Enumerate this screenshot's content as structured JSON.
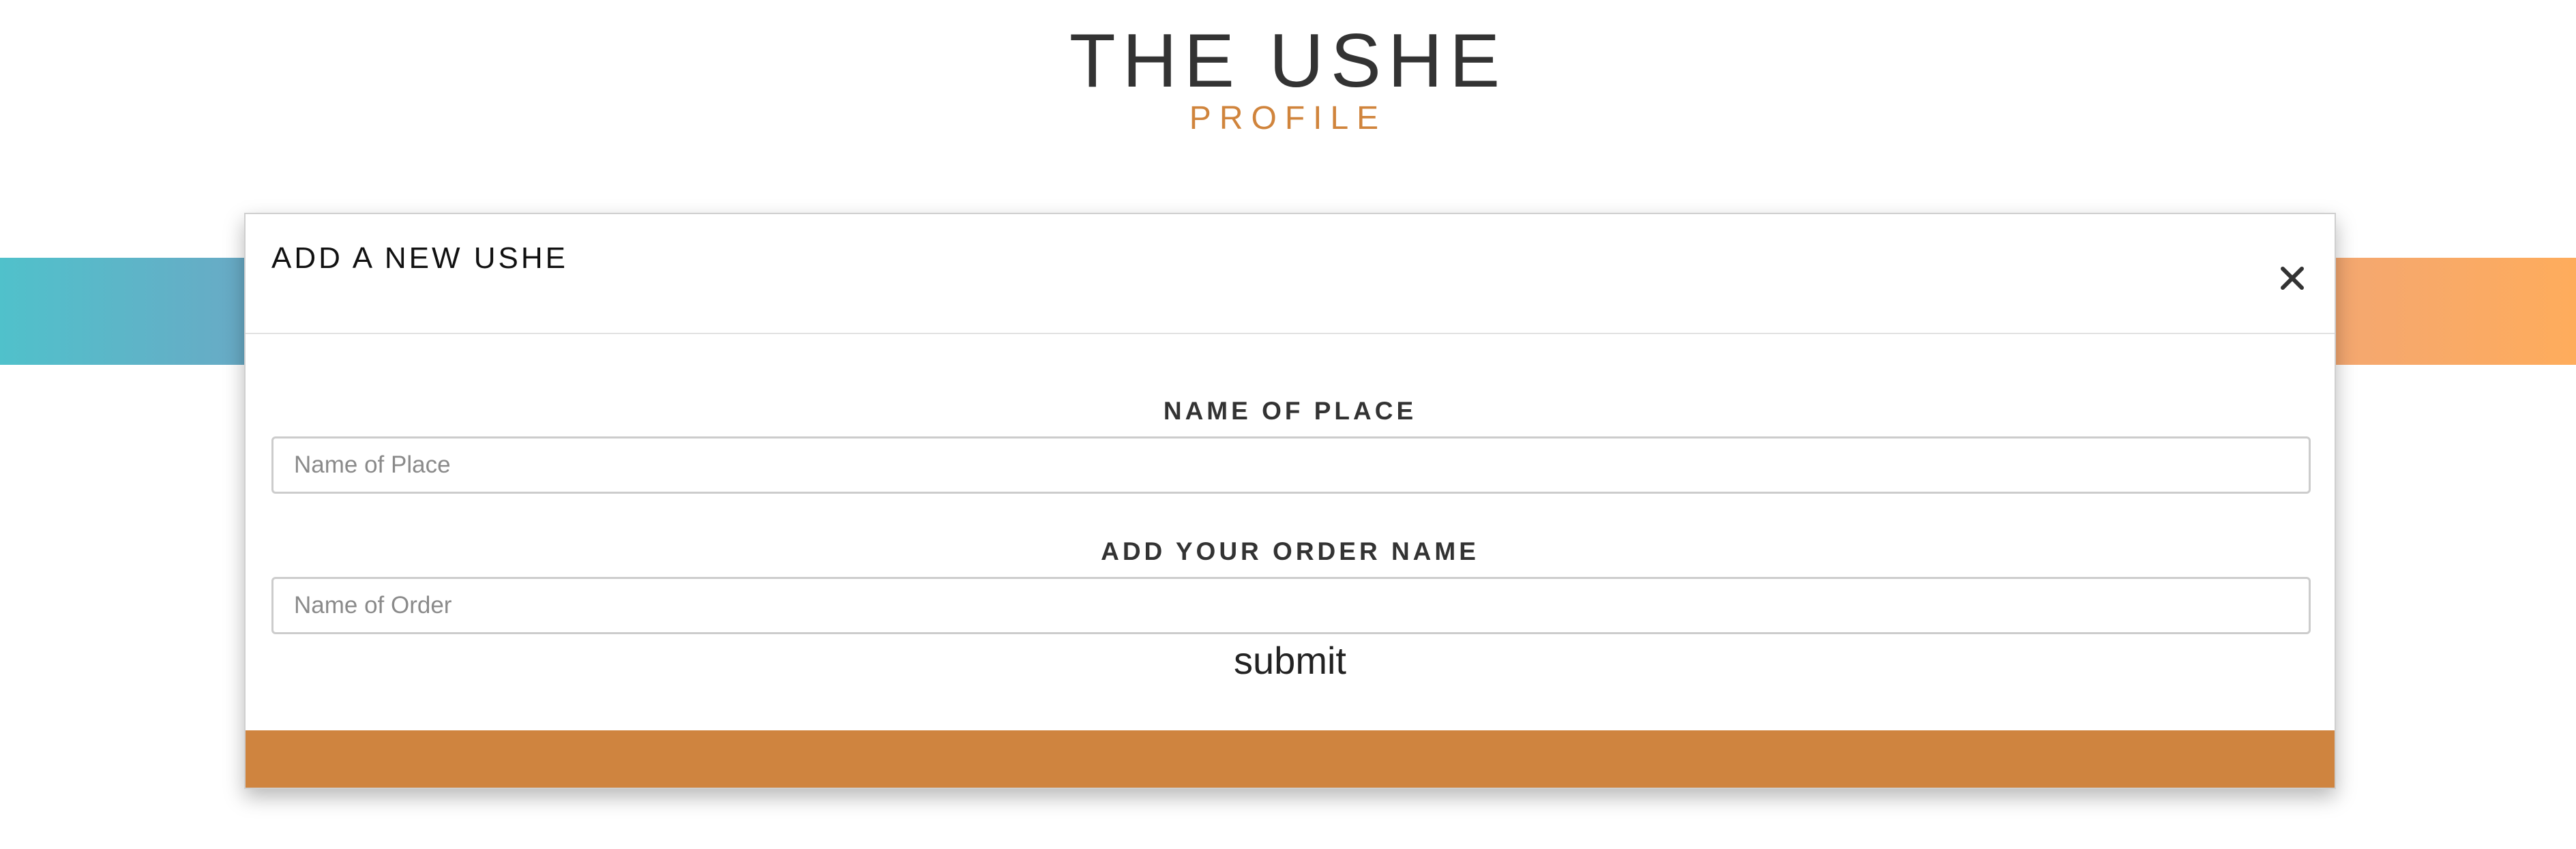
{
  "brand": {
    "title": "THE USHE",
    "subtitle": "PROFILE"
  },
  "modal": {
    "title": "ADD A NEW USHE",
    "close_icon": "close-icon",
    "fields": [
      {
        "label": "NAME OF PLACE",
        "placeholder": "Name of Place",
        "value": ""
      },
      {
        "label": "ADD YOUR ORDER NAME",
        "placeholder": "Name of Order",
        "value": ""
      }
    ],
    "submit_label": "submit"
  },
  "colors": {
    "accent": "#cf843f",
    "gradient_start": "#50c1cb",
    "gradient_end": "#feac5c",
    "title_text": "#333333"
  }
}
